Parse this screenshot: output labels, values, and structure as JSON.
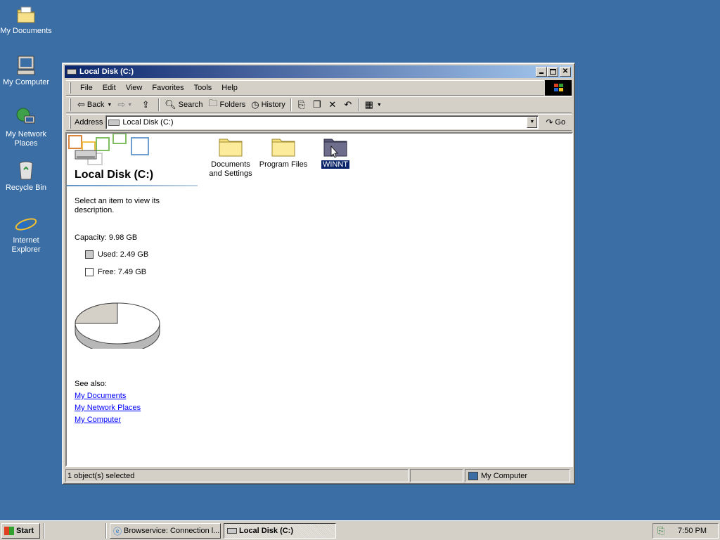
{
  "desktop": {
    "icons": [
      {
        "label": "My Documents"
      },
      {
        "label": "My Computer"
      },
      {
        "label": "My Network Places"
      },
      {
        "label": "Recycle Bin"
      },
      {
        "label": "Internet Explorer"
      }
    ]
  },
  "window": {
    "title": "Local Disk (C:)",
    "menu": [
      "File",
      "Edit",
      "View",
      "Favorites",
      "Tools",
      "Help"
    ],
    "toolbar": {
      "back": "Back",
      "search": "Search",
      "folders": "Folders",
      "history": "History"
    },
    "address": {
      "label": "Address",
      "value": "Local Disk (C:)",
      "go": "Go"
    },
    "sidebar": {
      "title": "Local Disk (C:)",
      "description": "Select an item to view its description.",
      "capacity": "Capacity: 9.98 GB",
      "used": "Used: 2.49 GB",
      "free": "Free: 7.49 GB",
      "used_fraction": 0.25,
      "see_also": "See also:",
      "links": [
        "My Documents",
        "My Network Places",
        "My Computer"
      ]
    },
    "files": [
      {
        "label": "Documents and Settings",
        "selected": false
      },
      {
        "label": "Program Files",
        "selected": false
      },
      {
        "label": "WINNT",
        "selected": true
      }
    ],
    "status": {
      "selection": "1 object(s) selected",
      "zone": "My Computer"
    }
  },
  "taskbar": {
    "start": "Start",
    "tasks": [
      {
        "label": "Browservice: Connection l...",
        "active": false
      },
      {
        "label": "Local Disk (C:)",
        "active": true
      }
    ],
    "clock": "7:50 PM"
  },
  "colors": {
    "desktop": "#3a6ea5",
    "title_gradient_start": "#0a246a",
    "selection": "#0a246a",
    "link": "#0000ff"
  }
}
